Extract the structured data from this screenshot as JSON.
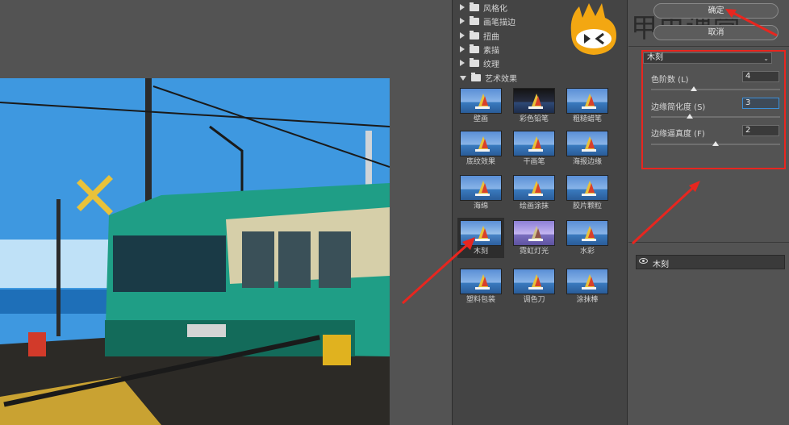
{
  "filter_gallery": {
    "folders": [
      {
        "label": "风格化",
        "expanded": false
      },
      {
        "label": "画笔描边",
        "expanded": false
      },
      {
        "label": "扭曲",
        "expanded": false
      },
      {
        "label": "素描",
        "expanded": false
      },
      {
        "label": "纹理",
        "expanded": false
      },
      {
        "label": "艺术效果",
        "expanded": true
      }
    ],
    "artistic_filters": [
      {
        "label": "壁画",
        "style": "normal",
        "selected": false
      },
      {
        "label": "彩色铅笔",
        "style": "dark",
        "selected": false
      },
      {
        "label": "粗糙蜡笔",
        "style": "normal",
        "selected": false
      },
      {
        "label": "底纹效果",
        "style": "normal",
        "selected": false
      },
      {
        "label": "干画笔",
        "style": "normal",
        "selected": false
      },
      {
        "label": "海报边缘",
        "style": "normal",
        "selected": false
      },
      {
        "label": "海绵",
        "style": "normal",
        "selected": false
      },
      {
        "label": "绘画涂抹",
        "style": "normal",
        "selected": false
      },
      {
        "label": "胶片颗粒",
        "style": "normal",
        "selected": false
      },
      {
        "label": "木刻",
        "style": "wood",
        "selected": true
      },
      {
        "label": "霓虹灯光",
        "style": "neon",
        "selected": false
      },
      {
        "label": "水彩",
        "style": "normal",
        "selected": false
      },
      {
        "label": "塑料包装",
        "style": "normal",
        "selected": false
      },
      {
        "label": "调色刀",
        "style": "normal",
        "selected": false
      },
      {
        "label": "涂抹棒",
        "style": "normal",
        "selected": false
      }
    ]
  },
  "settings": {
    "ok_label": "确定",
    "cancel_label": "取消",
    "filter_select": "木刻",
    "params": [
      {
        "label": "色阶数 (L)",
        "value": "4",
        "level_fraction": 0.33,
        "active": false
      },
      {
        "label": "边缘简化度 (S)",
        "value": "3",
        "level_fraction": 0.3,
        "active": true
      },
      {
        "label": "边缘逼真度 (F)",
        "value": "2",
        "level_fraction": 0.5,
        "active": false
      }
    ],
    "layer_name": "木刻"
  },
  "watermark": "甲虫课堂",
  "colors": {
    "highlight_red": "#e8261f",
    "panel_bg": "#444444",
    "app_bg": "#535353"
  }
}
